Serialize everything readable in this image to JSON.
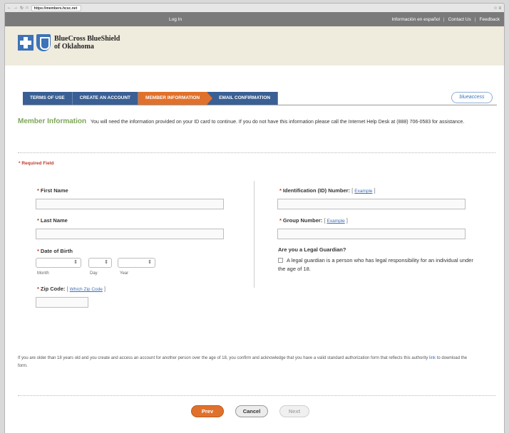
{
  "browser": {
    "url": "https://members.hcsc.net"
  },
  "topbar": {
    "login": "Log In",
    "spanish": "Información en español",
    "contact": "Contact Us",
    "feedback": "Feedback",
    "sep1": "|",
    "sep2": "|"
  },
  "brand": {
    "line1": "BlueCross BlueShield",
    "line2": "of Oklahoma"
  },
  "steps": [
    "TERMS OF USE",
    "CREATE AN ACCOUNT",
    "MEMBER INFORMATION",
    "EMAIL CONFIRMATION"
  ],
  "blueaccess_logo": "blueaccess",
  "intro": {
    "title": "Member Information",
    "text": "You will need the information provided on your ID card to continue. If you do not have this information please call the Internet Help Desk at (888) 706-0583 for assistance."
  },
  "required_note": "* Required Field",
  "form": {
    "star": "*",
    "first_name": "First Name",
    "last_name": "Last Name",
    "dob": "Date of Birth",
    "month": "Month",
    "day": "Day",
    "year": "Year",
    "zip": "Zip Code:",
    "zip_link": "Which Zip Code",
    "id_number": "Identification (ID) Number:",
    "group_number": "Group Number:",
    "example": "Example",
    "bracket_open": "[",
    "bracket_close": "]",
    "guardian_q": "Are you a Legal Guardian?",
    "guardian_text": "A legal guardian is a person who has legal responsibility for an individual under the age of 18."
  },
  "footnote": {
    "text": "If you are older than 18 years old and you create and access an account for another person over the age of 18, you confirm and acknowledge that you have a valid standard authorization form that reflects this authority",
    "link": "link",
    "tail": "to download the form."
  },
  "buttons": {
    "prev": "Prev",
    "cancel": "Cancel",
    "next": "Next"
  },
  "colors": {
    "accent": "#e0712c",
    "tab_blue": "#3a5f94",
    "brand_blue": "#3d73b8",
    "green": "#7ea55a"
  }
}
